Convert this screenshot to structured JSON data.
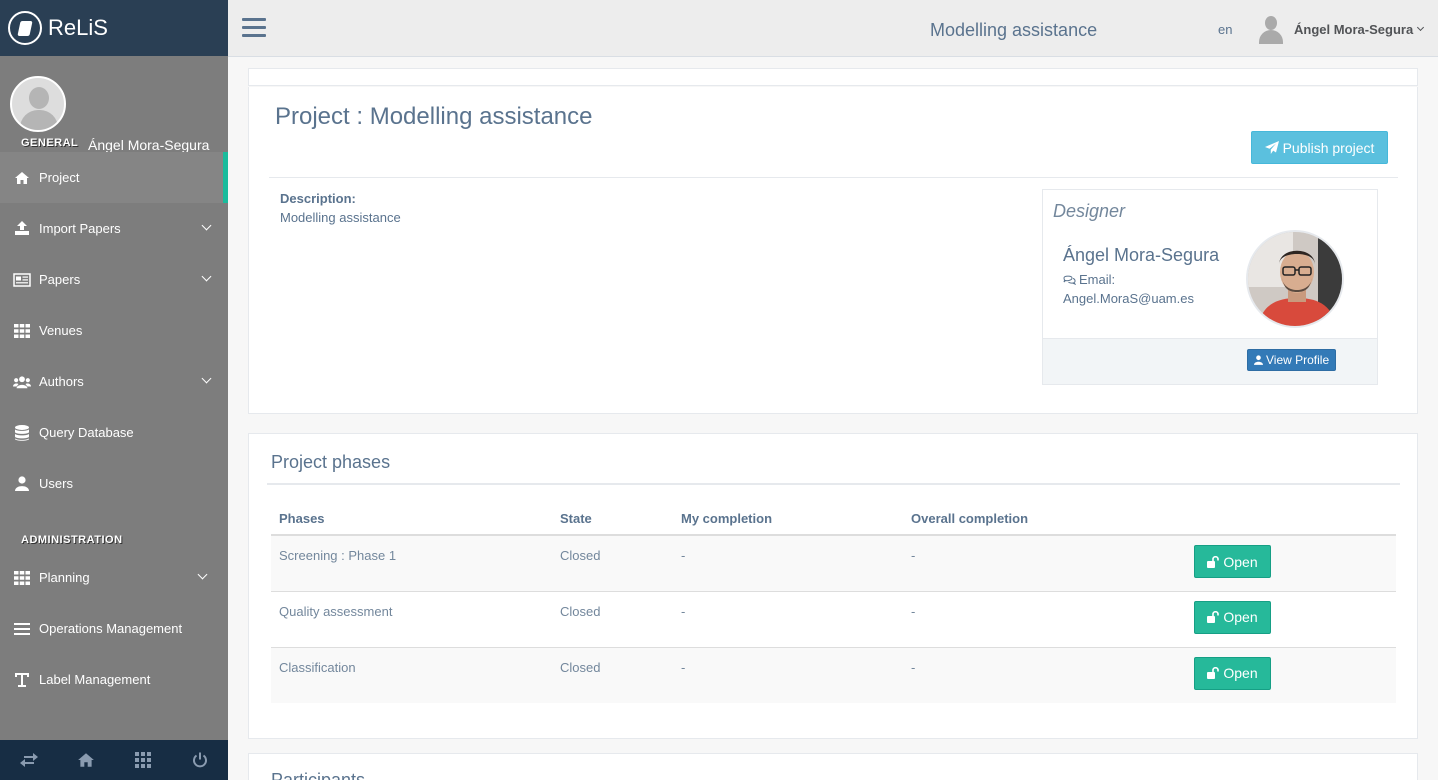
{
  "brand": {
    "name": "ReLiS"
  },
  "sidebar": {
    "user_name": "Ángel Mora-Segura",
    "general_title": "GENERAL",
    "general_items": [
      {
        "label": "Project",
        "icon": "home-icon",
        "active": true
      },
      {
        "label": "Import Papers",
        "icon": "upload-icon",
        "has_submenu": true
      },
      {
        "label": "Papers",
        "icon": "newspaper-icon",
        "has_submenu": true
      },
      {
        "label": "Venues",
        "icon": "grid-icon"
      },
      {
        "label": "Authors",
        "icon": "users-icon",
        "has_submenu": true
      },
      {
        "label": "Query Database",
        "icon": "database-icon"
      },
      {
        "label": "Users",
        "icon": "user-icon"
      }
    ],
    "admin_title": "ADMINISTRATION",
    "admin_items": [
      {
        "label": "Planning",
        "icon": "grid-icon",
        "has_submenu": true
      },
      {
        "label": "Operations Management",
        "icon": "list-icon"
      },
      {
        "label": "Label Management",
        "icon": "text-icon"
      }
    ],
    "footer_icons": [
      "exchange-icon",
      "home-icon",
      "grid-icon",
      "power-icon"
    ]
  },
  "topbar": {
    "title": "Modelling assistance",
    "language": "en",
    "user_name": "Ángel Mora-Segura"
  },
  "project": {
    "title": "Project : Modelling assistance",
    "publish_label": "Publish project",
    "description_label": "Description:",
    "description_value": "Modelling assistance",
    "designer": {
      "heading": "Designer",
      "name": "Ángel Mora-Segura",
      "email_label": "Email:",
      "email": "Angel.MoraS@uam.es",
      "view_profile_label": "View Profile"
    }
  },
  "phases": {
    "title": "Project phases",
    "columns": [
      "Phases",
      "State",
      "My completion",
      "Overall completion",
      ""
    ],
    "rows": [
      {
        "phase": "Screening : Phase 1",
        "state": "Closed",
        "my_completion": "-",
        "overall_completion": "-",
        "action": "Open"
      },
      {
        "phase": "Quality assessment",
        "state": "Closed",
        "my_completion": "-",
        "overall_completion": "-",
        "action": "Open"
      },
      {
        "phase": "Classification",
        "state": "Closed",
        "my_completion": "-",
        "overall_completion": "-",
        "action": "Open"
      }
    ]
  },
  "participants": {
    "title": "Participants"
  },
  "colors": {
    "sidebar_bg": "#7d7d7d",
    "brand_bg": "#2a3f54",
    "accent_green": "#26b99a",
    "info_blue": "#5bc0de",
    "primary_blue": "#337ab7",
    "active_marker": "#1abb9c"
  }
}
